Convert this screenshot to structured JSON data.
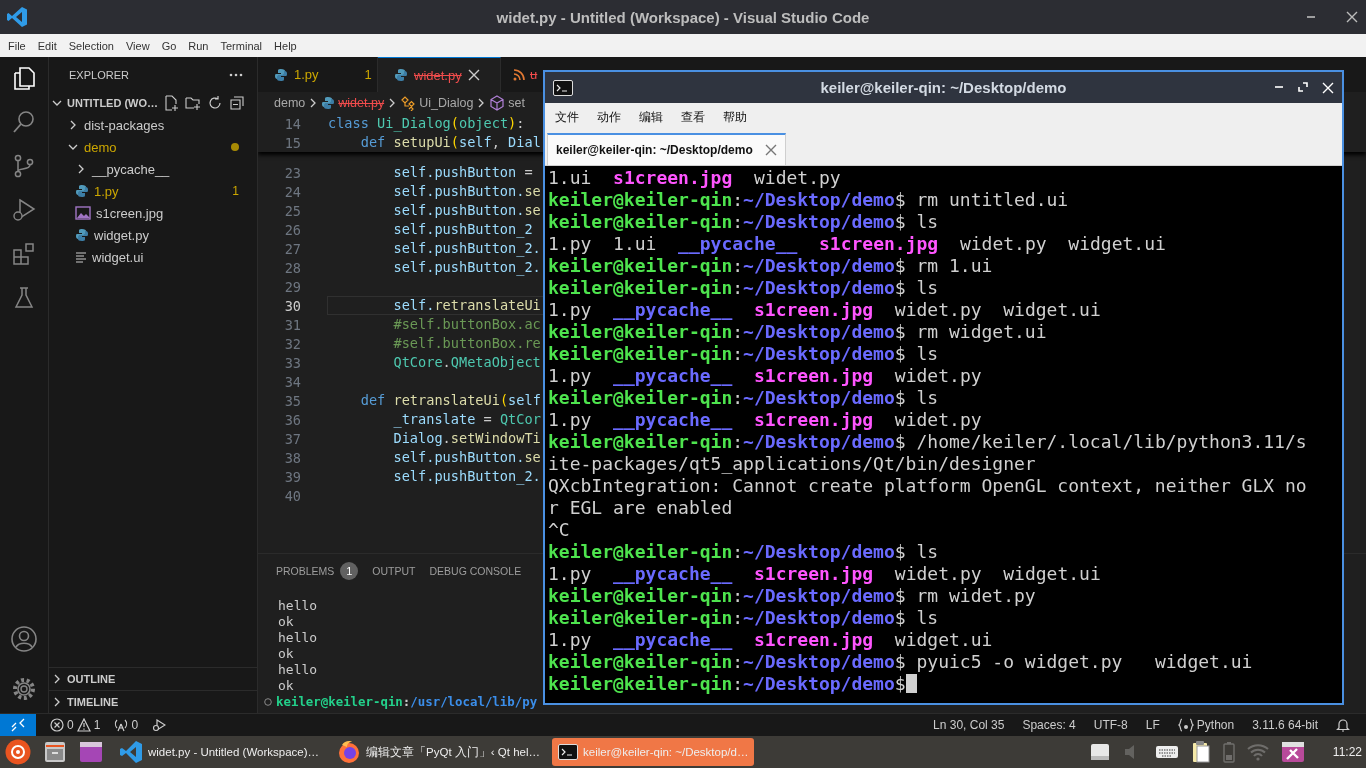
{
  "vscode": {
    "title": "widet.py - Untitled (Workspace) - Visual Studio Code",
    "menu": [
      "File",
      "Edit",
      "Selection",
      "View",
      "Go",
      "Run",
      "Terminal",
      "Help"
    ],
    "activity_bar": [
      {
        "kind": "explorer",
        "selected": true
      },
      {
        "kind": "search",
        "selected": false
      },
      {
        "kind": "source_control",
        "selected": false
      },
      {
        "kind": "run_debug",
        "selected": false
      },
      {
        "kind": "extensions",
        "selected": false
      },
      {
        "kind": "testing",
        "selected": false
      }
    ],
    "activity_bottom": [
      {
        "kind": "accounts"
      },
      {
        "kind": "settings"
      }
    ],
    "sidebar": {
      "title": "EXPLORER",
      "workspace": {
        "label": "UNTITLED (WO…",
        "expanded": true
      },
      "tree": [
        {
          "label": "dist-packages",
          "kind": "folder",
          "expanded": false,
          "warning": false
        },
        {
          "label": "demo",
          "kind": "folder",
          "expanded": true,
          "warning": true,
          "children": [
            {
              "label": "__pycache__",
              "kind": "folder",
              "expanded": false,
              "warning": false
            },
            {
              "label": "1.py",
              "kind": "python",
              "warning": true,
              "badge": "1"
            },
            {
              "label": "s1creen.jpg",
              "kind": "image",
              "warning": false
            },
            {
              "label": "widget.py",
              "kind": "python",
              "warning": false
            },
            {
              "label": "widget.ui",
              "kind": "text",
              "warning": false
            }
          ]
        }
      ],
      "sections": [
        {
          "label": "OUTLINE",
          "expanded": false
        },
        {
          "label": "TIMELINE",
          "expanded": false
        }
      ]
    },
    "editor": {
      "tabs": [
        {
          "label": "1.py",
          "kind": "python",
          "badge": "1",
          "warning": true,
          "deleted": false,
          "selected": false
        },
        {
          "label": "widet.py",
          "kind": "python",
          "warning": false,
          "deleted": true,
          "selected": true
        },
        {
          "label": "u",
          "kind": "rss",
          "warning": false,
          "deleted": true,
          "selected": false
        }
      ],
      "breadcrumbs": [
        {
          "label": "demo",
          "kind": "folder",
          "deleted": false
        },
        {
          "label": "widet.py",
          "kind": "python",
          "deleted": true
        },
        {
          "label": "Ui_Dialog",
          "kind": "class",
          "deleted": false
        },
        {
          "label": "set",
          "kind": "method",
          "deleted": false
        }
      ],
      "sticky_lines": [
        {
          "number": "14",
          "current": false,
          "tokens": [
            {
              "text": "class ",
              "kind": "keyword"
            },
            {
              "text": "Ui_Dialog",
              "kind": "class"
            },
            {
              "text": "(",
              "kind": "bracket"
            },
            {
              "text": "object",
              "kind": "class"
            },
            {
              "text": ")",
              "kind": "bracket"
            },
            {
              "text": ":",
              "kind": "plain"
            }
          ]
        },
        {
          "number": "15",
          "current": false,
          "tokens": [
            {
              "text": "    def ",
              "kind": "keyword"
            },
            {
              "text": "setupUi",
              "kind": "function"
            },
            {
              "text": "(",
              "kind": "bracket"
            },
            {
              "text": "self",
              "kind": "variable"
            },
            {
              "text": ", ",
              "kind": "plain"
            },
            {
              "text": "Dial",
              "kind": "variable"
            }
          ]
        }
      ],
      "lines": [
        {
          "number": "23",
          "current": false,
          "tokens": [
            {
              "text": "        self.pushButton",
              "kind": "variable"
            },
            {
              "text": " =",
              "kind": "plain"
            }
          ]
        },
        {
          "number": "24",
          "current": false,
          "tokens": [
            {
              "text": "        self.pushButton.",
              "kind": "variable"
            },
            {
              "text": "se",
              "kind": "function"
            }
          ]
        },
        {
          "number": "25",
          "current": false,
          "tokens": [
            {
              "text": "        self.pushButton.",
              "kind": "variable"
            },
            {
              "text": "se",
              "kind": "function"
            }
          ]
        },
        {
          "number": "26",
          "current": false,
          "tokens": [
            {
              "text": "        self.pushButton_2",
              "kind": "variable"
            }
          ]
        },
        {
          "number": "27",
          "current": false,
          "tokens": [
            {
              "text": "        self.pushButton_2.",
              "kind": "variable"
            }
          ]
        },
        {
          "number": "28",
          "current": false,
          "tokens": [
            {
              "text": "        self.pushButton_2.",
              "kind": "variable"
            }
          ]
        },
        {
          "number": "29",
          "current": false
        },
        {
          "number": "30",
          "current": true,
          "tokens": [
            {
              "text": "        self.",
              "kind": "variable"
            },
            {
              "text": "retranslateUi",
              "kind": "function"
            }
          ]
        },
        {
          "number": "31",
          "current": false,
          "tokens": [
            {
              "text": "        #self.buttonBox.ac",
              "kind": "comment"
            }
          ]
        },
        {
          "number": "32",
          "current": false,
          "tokens": [
            {
              "text": "        #self.buttonBox.re",
              "kind": "comment"
            }
          ]
        },
        {
          "number": "33",
          "current": false,
          "tokens": [
            {
              "text": "        QtCore",
              "kind": "class"
            },
            {
              "text": ".",
              "kind": "plain"
            },
            {
              "text": "QMetaObject",
              "kind": "class"
            }
          ]
        },
        {
          "number": "34",
          "current": false
        },
        {
          "number": "35",
          "current": false,
          "tokens": [
            {
              "text": "    def ",
              "kind": "keyword"
            },
            {
              "text": "retranslateUi",
              "kind": "function"
            },
            {
              "text": "(",
              "kind": "bracket"
            },
            {
              "text": "self",
              "kind": "variable"
            }
          ]
        },
        {
          "number": "36",
          "current": false,
          "tokens": [
            {
              "text": "        _translate",
              "kind": "variable"
            },
            {
              "text": " = ",
              "kind": "plain"
            },
            {
              "text": "QtCor",
              "kind": "class"
            }
          ]
        },
        {
          "number": "37",
          "current": false,
          "tokens": [
            {
              "text": "        Dialog",
              "kind": "variable"
            },
            {
              "text": ".",
              "kind": "plain"
            },
            {
              "text": "setWindowTi",
              "kind": "function"
            }
          ]
        },
        {
          "number": "38",
          "current": false,
          "tokens": [
            {
              "text": "        self.pushButton.",
              "kind": "variable"
            },
            {
              "text": "se",
              "kind": "function"
            }
          ]
        },
        {
          "number": "39",
          "current": false,
          "tokens": [
            {
              "text": "        self.pushButton_2.",
              "kind": "variable"
            }
          ]
        },
        {
          "number": "40",
          "current": false
        }
      ]
    },
    "panel": {
      "tabs": [
        {
          "label": "PROBLEMS",
          "badge": "1",
          "selected": false
        },
        {
          "label": "OUTPUT",
          "selected": false
        },
        {
          "label": "DEBUG CONSOLE",
          "selected": false
        }
      ],
      "output": [
        "hello",
        "ok",
        "hello",
        "ok",
        "hello",
        "ok"
      ],
      "prompt": {
        "user": "keiler@keiler-qin",
        "sep": ":",
        "path": "/usr/local/lib/py"
      }
    },
    "status_bar": {
      "left": [
        {
          "kind": "remote"
        },
        {
          "kind": "errors",
          "text": "0"
        },
        {
          "kind": "warnings",
          "text": "1"
        },
        {
          "kind": "ports",
          "text": "0"
        },
        {
          "kind": "debug"
        }
      ],
      "right": [
        {
          "kind": "position",
          "text": "Ln 30, Col 35"
        },
        {
          "kind": "indent",
          "text": "Spaces: 4"
        },
        {
          "kind": "encoding",
          "text": "UTF-8"
        },
        {
          "kind": "eol",
          "text": "LF"
        },
        {
          "kind": "language",
          "text": "Python"
        },
        {
          "kind": "interpreter",
          "text": "3.11.6 64-bit"
        },
        {
          "kind": "bell"
        }
      ]
    }
  },
  "terminal": {
    "title": "keiler@keiler-qin: ~/Desktop/demo",
    "menu": [
      "文件",
      "动作",
      "编辑",
      "查看",
      "帮助"
    ],
    "tabs": [
      {
        "label": "keiler@keiler-qin: ~/Desktop/demo",
        "selected": true
      }
    ],
    "lines": [
      {
        "kind": "listing",
        "items": [
          {
            "name": "1.ui",
            "kind": "file"
          },
          {
            "name": "s1creen.jpg",
            "kind": "image"
          },
          {
            "name": "widet.py",
            "kind": "file"
          }
        ]
      },
      {
        "kind": "prompt",
        "user": "keiler@keiler-qin",
        "sep": ":",
        "path": "~/Desktop/demo",
        "symbol": "$",
        "command": " rm untitled.ui"
      },
      {
        "kind": "prompt",
        "user": "keiler@keiler-qin",
        "sep": ":",
        "path": "~/Desktop/demo",
        "symbol": "$",
        "command": " ls"
      },
      {
        "kind": "listing",
        "items": [
          {
            "name": "1.py",
            "kind": "file"
          },
          {
            "name": "1.ui",
            "kind": "file"
          },
          {
            "name": "__pycache__",
            "kind": "dir"
          },
          {
            "name": "s1creen.jpg",
            "kind": "image"
          },
          {
            "name": "widet.py",
            "kind": "file"
          },
          {
            "name": "widget.ui",
            "kind": "file"
          }
        ]
      },
      {
        "kind": "prompt",
        "user": "keiler@keiler-qin",
        "sep": ":",
        "path": "~/Desktop/demo",
        "symbol": "$",
        "command": " rm 1.ui"
      },
      {
        "kind": "prompt",
        "user": "keiler@keiler-qin",
        "sep": ":",
        "path": "~/Desktop/demo",
        "symbol": "$",
        "command": " ls"
      },
      {
        "kind": "listing",
        "items": [
          {
            "name": "1.py",
            "kind": "file"
          },
          {
            "name": "__pycache__",
            "kind": "dir"
          },
          {
            "name": "s1creen.jpg",
            "kind": "image"
          },
          {
            "name": "widet.py",
            "kind": "file"
          },
          {
            "name": "widget.ui",
            "kind": "file"
          }
        ]
      },
      {
        "kind": "prompt",
        "user": "keiler@keiler-qin",
        "sep": ":",
        "path": "~/Desktop/demo",
        "symbol": "$",
        "command": " rm widget.ui"
      },
      {
        "kind": "prompt",
        "user": "keiler@keiler-qin",
        "sep": ":",
        "path": "~/Desktop/demo",
        "symbol": "$",
        "command": " ls"
      },
      {
        "kind": "listing",
        "items": [
          {
            "name": "1.py",
            "kind": "file"
          },
          {
            "name": "__pycache__",
            "kind": "dir"
          },
          {
            "name": "s1creen.jpg",
            "kind": "image"
          },
          {
            "name": "widet.py",
            "kind": "file"
          }
        ]
      },
      {
        "kind": "prompt",
        "user": "keiler@keiler-qin",
        "sep": ":",
        "path": "~/Desktop/demo",
        "symbol": "$",
        "command": " ls"
      },
      {
        "kind": "listing",
        "items": [
          {
            "name": "1.py",
            "kind": "file"
          },
          {
            "name": "__pycache__",
            "kind": "dir"
          },
          {
            "name": "s1creen.jpg",
            "kind": "image"
          },
          {
            "name": "widet.py",
            "kind": "file"
          }
        ]
      },
      {
        "kind": "prompt",
        "user": "keiler@keiler-qin",
        "sep": ":",
        "path": "~/Desktop/demo",
        "symbol": "$",
        "command": " /home/keiler/.local/lib/python3.11/site-packages/qt5_applications/Qt/bin/designer"
      },
      {
        "kind": "text",
        "text": "QXcbIntegration: Cannot create platform OpenGL context, neither GLX nor EGL are enabled"
      },
      {
        "kind": "text",
        "text": "^C"
      },
      {
        "kind": "prompt",
        "user": "keiler@keiler-qin",
        "sep": ":",
        "path": "~/Desktop/demo",
        "symbol": "$",
        "command": " ls"
      },
      {
        "kind": "listing",
        "items": [
          {
            "name": "1.py",
            "kind": "file"
          },
          {
            "name": "__pycache__",
            "kind": "dir"
          },
          {
            "name": "s1creen.jpg",
            "kind": "image"
          },
          {
            "name": "widet.py",
            "kind": "file"
          },
          {
            "name": "widget.ui",
            "kind": "file"
          }
        ]
      },
      {
        "kind": "prompt",
        "user": "keiler@keiler-qin",
        "sep": ":",
        "path": "~/Desktop/demo",
        "symbol": "$",
        "command": " rm widet.py"
      },
      {
        "kind": "prompt",
        "user": "keiler@keiler-qin",
        "sep": ":",
        "path": "~/Desktop/demo",
        "symbol": "$",
        "command": " ls"
      },
      {
        "kind": "listing",
        "items": [
          {
            "name": "1.py",
            "kind": "file"
          },
          {
            "name": "__pycache__",
            "kind": "dir"
          },
          {
            "name": "s1creen.jpg",
            "kind": "image"
          },
          {
            "name": "widget.ui",
            "kind": "file"
          }
        ]
      },
      {
        "kind": "prompt",
        "user": "keiler@keiler-qin",
        "sep": ":",
        "path": "~/Desktop/demo",
        "symbol": "$",
        "command": " pyuic5 -o widget.py   widget.ui"
      },
      {
        "kind": "prompt",
        "user": "keiler@keiler-qin",
        "sep": ":",
        "path": "~/Desktop/demo",
        "symbol": "$",
        "cursor": true
      }
    ]
  },
  "taskbar": {
    "launchers": [
      {
        "kind": "start"
      },
      {
        "kind": "files"
      },
      {
        "kind": "app"
      }
    ],
    "tasks": [
      {
        "kind": "vscode",
        "label": "widet.py - Untitled (Workspace)…",
        "selected": false
      },
      {
        "kind": "firefox",
        "label": "编辑文章「PyQt 入门」‹ Qt hel…",
        "selected": false
      },
      {
        "kind": "terminal",
        "label": "keiler@keiler-qin: ~/Desktop/d…",
        "selected": true
      }
    ],
    "tray": [
      {
        "kind": "drive",
        "dimmed": false
      },
      {
        "kind": "volume",
        "dimmed": true
      },
      {
        "kind": "keyboard",
        "dimmed": false
      },
      {
        "kind": "clipboard",
        "dimmed": false
      },
      {
        "kind": "battery",
        "dimmed": true
      },
      {
        "kind": "wifi",
        "dimmed": true
      },
      {
        "kind": "app",
        "dimmed": false
      }
    ],
    "clock": "11:22"
  }
}
